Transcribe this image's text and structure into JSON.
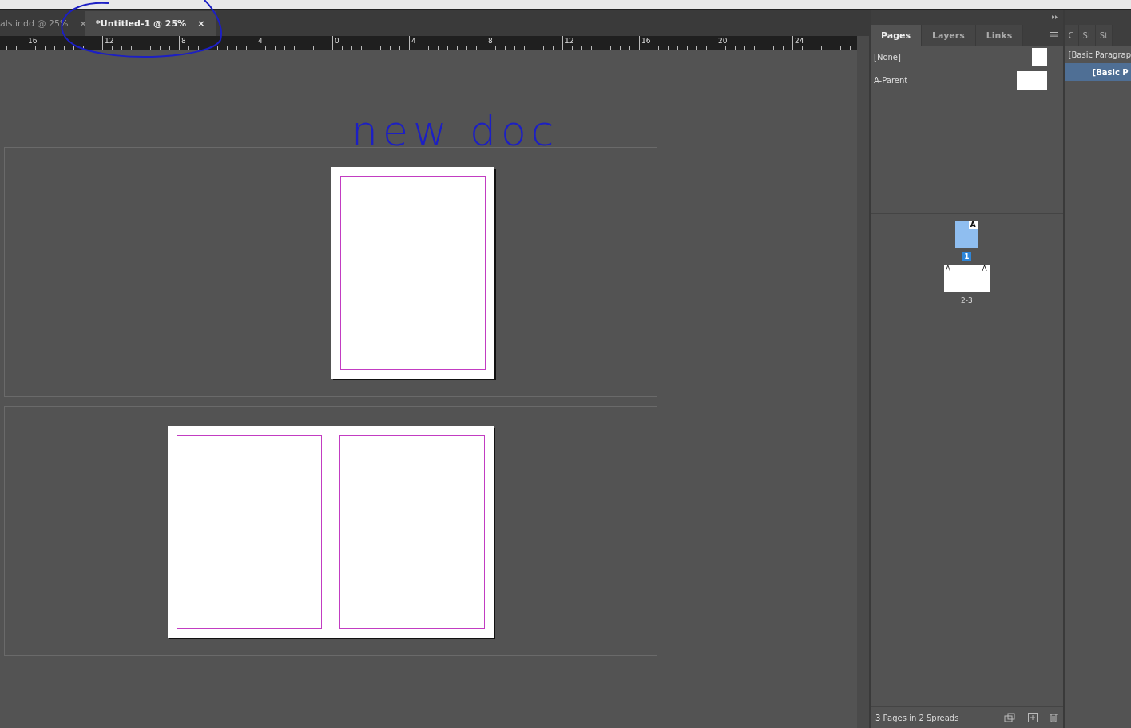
{
  "tabs": [
    {
      "label": "als.indd @ 25%",
      "close": "×",
      "selected": false
    },
    {
      "label": "*Untitled-1 @ 25%",
      "close": "×",
      "selected": true
    }
  ],
  "ruler": {
    "labels": [
      "16",
      "12",
      "8",
      "4",
      "0",
      "4",
      "8",
      "12",
      "16",
      "20",
      "24"
    ]
  },
  "annotation": "new doc",
  "spreads": [
    {
      "kind": "single"
    },
    {
      "kind": "facing"
    }
  ],
  "pages_panel": {
    "tabs": [
      {
        "label": "Pages",
        "selected": true
      },
      {
        "label": "Layers",
        "selected": false
      },
      {
        "label": "Links",
        "selected": false
      }
    ],
    "parents": [
      {
        "label": "[None]",
        "kind": "single"
      },
      {
        "label": "A-Parent",
        "kind": "facing"
      }
    ],
    "thumbnails": [
      {
        "kind": "single",
        "prefixes": [
          "A"
        ],
        "number": "1",
        "selected": true
      },
      {
        "kind": "facing",
        "prefixes": [
          "A",
          "A"
        ],
        "number": "2-3",
        "selected": false
      }
    ],
    "footer": "3 Pages in 2 Spreads"
  },
  "side_panel": {
    "tabs": [
      "C",
      "St",
      "St"
    ],
    "styles": [
      {
        "label": "[Basic Paragrap",
        "selected": false
      },
      {
        "label": "[Basic P",
        "selected": true
      }
    ]
  }
}
